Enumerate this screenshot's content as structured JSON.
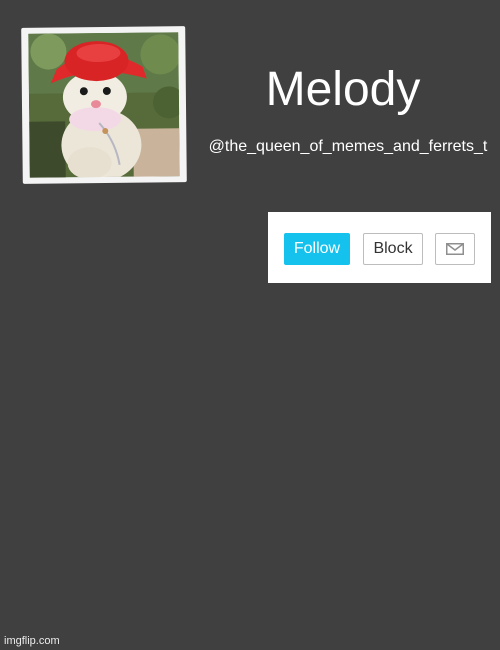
{
  "profile": {
    "display_name": "Melody",
    "username": "@the_queen_of_memes_and_ferrets_t",
    "photo_icon": "ferret-in-red-hat-photo"
  },
  "actions": {
    "follow_label": "Follow",
    "block_label": "Block",
    "message_icon": "envelope-icon"
  },
  "watermark": {
    "text": "imgflip.com"
  },
  "colors": {
    "background": "#404040",
    "follow_accent": "#15c2ee",
    "panel": "#ffffff"
  }
}
